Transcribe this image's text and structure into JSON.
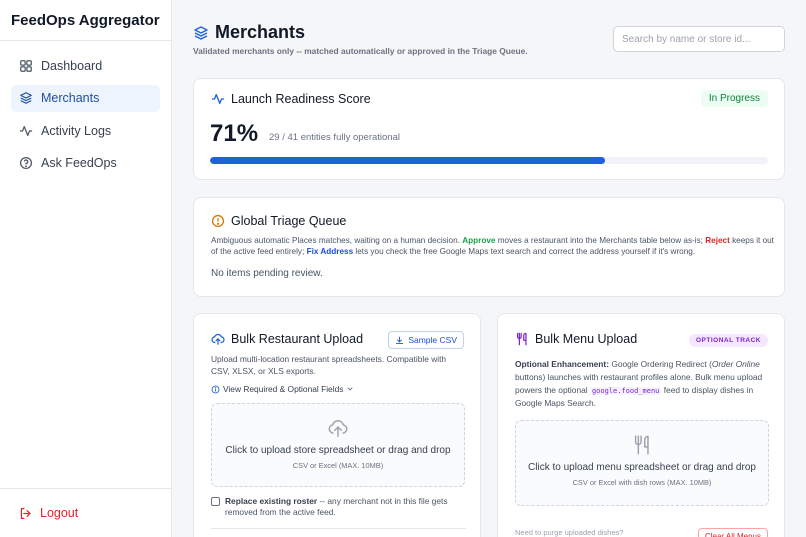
{
  "app": {
    "title": "FeedOps Aggregator"
  },
  "sidebar": {
    "items": [
      {
        "label": "Dashboard",
        "icon": "grid-icon"
      },
      {
        "label": "Merchants",
        "icon": "layers-icon",
        "active": true
      },
      {
        "label": "Activity Logs",
        "icon": "activity-icon"
      },
      {
        "label": "Ask FeedOps",
        "icon": "help-circle-icon"
      }
    ],
    "logout_label": "Logout"
  },
  "header": {
    "title": "Merchants",
    "subtitle": "Validated merchants only -- matched automatically or approved in the Triage Queue.",
    "search_placeholder": "Search by name or store id..."
  },
  "launch": {
    "title": "Launch Readiness Score",
    "status": "In Progress",
    "percent_label": "71%",
    "detail": "29 / 41 entities fully operational",
    "progress_fraction": 0.707
  },
  "triage": {
    "title": "Global Triage Queue",
    "desc_1": "Ambiguous automatic Places matches, waiting on a human decision. ",
    "approve": "Approve",
    "desc_2": " moves a restaurant into the Merchants table below as-is; ",
    "reject": "Reject",
    "desc_3": " keeps it out of the active feed entirely; ",
    "fix": "Fix Address",
    "desc_4": " lets you check the free Google Maps text search and correct the address yourself if it's wrong.",
    "empty": "No items pending review."
  },
  "bulk_restaurant": {
    "title": "Bulk Restaurant Upload",
    "sample_label": "Sample CSV",
    "desc": "Upload multi-location restaurant spreadsheets. Compatible with CSV, XLSX, or XLS exports.",
    "fields_link": "View Required & Optional Fields",
    "drop_main": "Click to upload store spreadsheet or drag and drop",
    "drop_sub": "CSV or Excel (MAX. 10MB)",
    "replace_bold": "Replace existing roster",
    "replace_rest": " -- any merchant not in this file gets removed from the active feed."
  },
  "bulk_menu": {
    "title": "Bulk Menu Upload",
    "badge": "OPTIONAL TRACK",
    "desc_bold": "Optional Enhancement:",
    "desc_1": " Google Ordering Redirect (",
    "desc_italic": "Order Online",
    "desc_2": " buttons) launches with restaurant profiles alone. Bulk menu upload powers the optional ",
    "code": "google.food_menu",
    "desc_3": " feed to display dishes in Google Maps Search.",
    "drop_main": "Click to upload menu spreadsheet or drag and drop",
    "drop_sub": "CSV or Excel with dish rows (MAX. 10MB)",
    "clear_hint": "Need to purge uploaded dishes?",
    "clear_label": "Clear All Menus"
  }
}
